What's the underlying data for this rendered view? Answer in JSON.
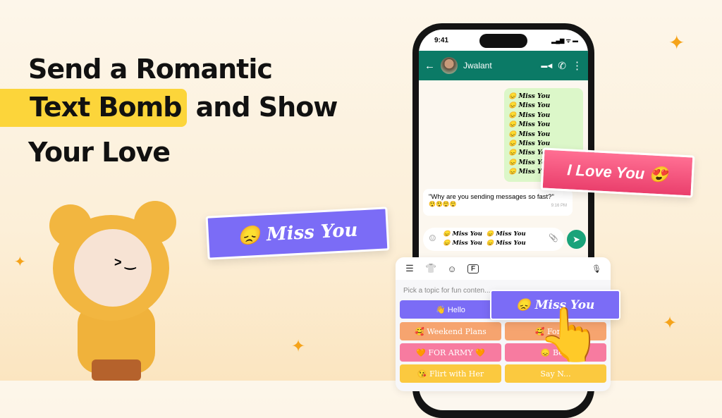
{
  "headline": {
    "line1": "Send a Romantic",
    "highlight": "Text Bomb",
    "line2_rest": "and Show",
    "line3": "Your Love"
  },
  "colors": {
    "highlight": "#fcd53a",
    "whatsapp_green": "#0b7a66",
    "purple": "#7b6cf6",
    "pink": "#f0557e",
    "orange": "#f6a46f",
    "sparkle": "#f5a31a"
  },
  "phone": {
    "status_time": "9:41",
    "status_icons": "▂▄▆ ᯤ ▬",
    "header": {
      "back_icon": "←",
      "contact_name": "Jwalant",
      "video_icon": "▬◀",
      "call_icon": "✆",
      "menu_icon": "⋮"
    },
    "sent_message": {
      "lines": [
        "😞 Miss You",
        "😞 Miss You",
        "😞 Miss You",
        "😞 Miss You",
        "😞 Miss You",
        "😞 Miss You",
        "😞 Miss You",
        "😞 Miss You",
        "😞 Miss You"
      ]
    },
    "received_message": {
      "text": "\"Why are you sending messages so fast?\"",
      "emojis": "😲😲😲😲",
      "time": "9:16 PM"
    },
    "input": {
      "emoji_icon": "☺",
      "lines": [
        "😞 Miss You  😞 Miss You",
        "😞 Miss You  😞 Miss You"
      ],
      "attach_icon": "📎",
      "send_icon": "➤"
    }
  },
  "keyboard": {
    "toolbar_icons": [
      "☰",
      "👕",
      "☺",
      "F"
    ],
    "mic_icon": "🎙",
    "prompt": "Pick a topic for fun conten...",
    "topics": [
      {
        "label": "👋 Hello",
        "color": "#7b6cf6"
      },
      {
        "label": "🥰 Weekend Plans",
        "color": "#f6a46f"
      },
      {
        "label": "🥰 For G...",
        "color": "#f6a46f"
      },
      {
        "label": "🧡 FOR ARMY 🧡",
        "color": "#f77ba0"
      },
      {
        "label": "😞 Be...",
        "color": "#f77ba0"
      },
      {
        "label": "😘 Flirt with Her",
        "color": "#fbc93f"
      },
      {
        "label": "Say N...",
        "color": "#fbc93f"
      }
    ],
    "selected": "😞 Miss You"
  },
  "cards": {
    "love": "I Love You 😍",
    "miss": "😞 Miss You"
  },
  "pointer_icon": "👆"
}
